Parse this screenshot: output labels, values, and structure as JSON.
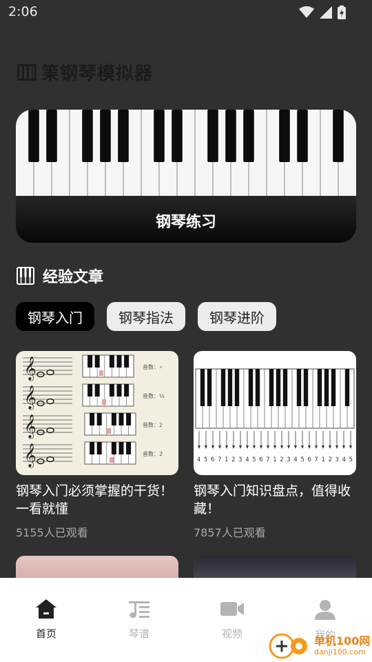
{
  "status": {
    "time": "2:06"
  },
  "app": {
    "title": "筙钢琴模拟器"
  },
  "hero": {
    "label": "钢琴练习"
  },
  "section": {
    "title": "经验文章"
  },
  "tabs": [
    {
      "label": "钢琴入门",
      "active": true
    },
    {
      "label": "钢琴指法",
      "active": false
    },
    {
      "label": "钢琴进阶",
      "active": false
    }
  ],
  "articles": [
    {
      "title": "钢琴入门必须掌握的干货！一看就懂",
      "views": "5155人已观看",
      "thumb_labels": [
        "音数：∘",
        "音数：½",
        "音数：2",
        "音数：2"
      ]
    },
    {
      "title": "钢琴入门知识盘点，值得收藏！",
      "views": "7857人已观看",
      "thumb_numbers": "4 5 6 7 1 2 3 4 5 6 7 1 2 3 4 5 6 7 1 2 3 4 5"
    }
  ],
  "nav": [
    {
      "label": "首页",
      "icon": "home-icon",
      "active": true
    },
    {
      "label": "琴谱",
      "icon": "sheet-music-icon",
      "active": false
    },
    {
      "label": "视频",
      "icon": "video-camera-icon",
      "active": false
    },
    {
      "label": "我的",
      "icon": "user-icon",
      "active": false
    }
  ],
  "watermark": {
    "name": "单机100网",
    "url": "danji100.com"
  },
  "colors": {
    "background": "#303030",
    "accent": "#000000",
    "tab_inactive": "#ececec",
    "nav_active": "#222222",
    "nav_inactive": "#b4b4b4"
  }
}
